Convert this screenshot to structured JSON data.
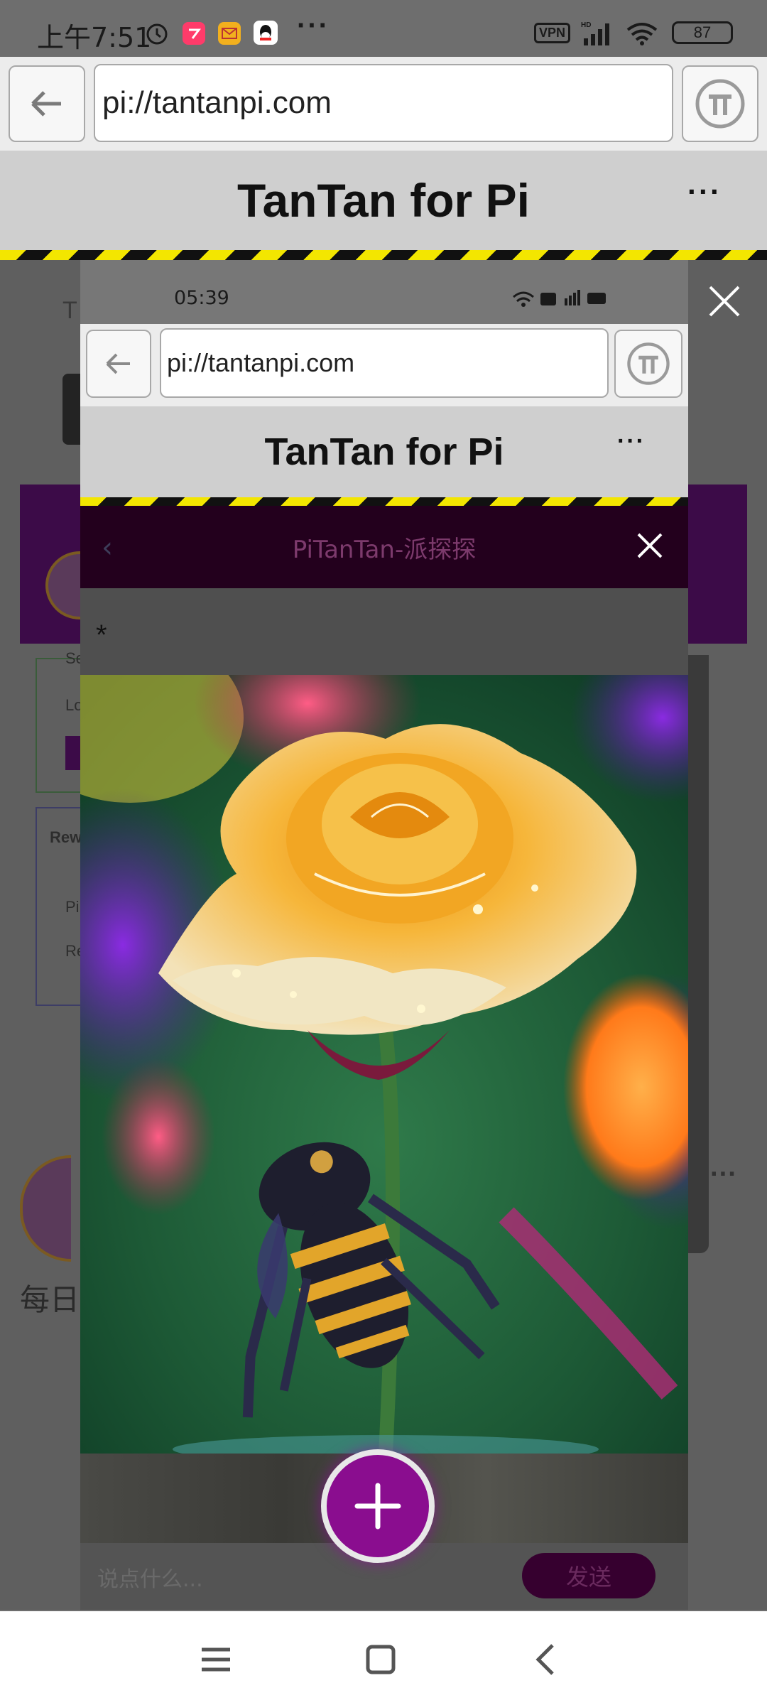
{
  "status_bar": {
    "time": "上午7:51",
    "more": "···",
    "vpn": "VPN",
    "battery": "87"
  },
  "browser": {
    "url": "pi://tantanpi.com",
    "title": "TanTan for Pi",
    "more": "···"
  },
  "inner": {
    "time": "05:39",
    "url": "pi://tantanpi.com",
    "title": "TanTan for Pi",
    "more": "···",
    "page_header": "PiTanTan-派探探",
    "asterisk": "*",
    "comment_placeholder": "说点什么...",
    "send_label": "发送"
  },
  "background": {
    "daily_text": "每日",
    "bg_label_1": "T",
    "bg_label_2": "Se",
    "bg_label_3": "Lo",
    "bg_label_4": "Rew",
    "bg_label_5": "Pi",
    "bg_label_6": "Re",
    "bg_more": "···"
  },
  "colors": {
    "accent_purple": "#8a0d8f",
    "hazard_yellow": "#f3e600",
    "title_bar": "#cfcfcf"
  },
  "icons": [
    "alarm-icon",
    "app-icon",
    "mail-icon",
    "qq-icon",
    "signal-icon",
    "wifi-icon",
    "battery-icon",
    "back-arrow-icon",
    "pi-logo-icon",
    "close-icon",
    "plus-icon",
    "menu-icon",
    "home-icon",
    "back-icon"
  ]
}
